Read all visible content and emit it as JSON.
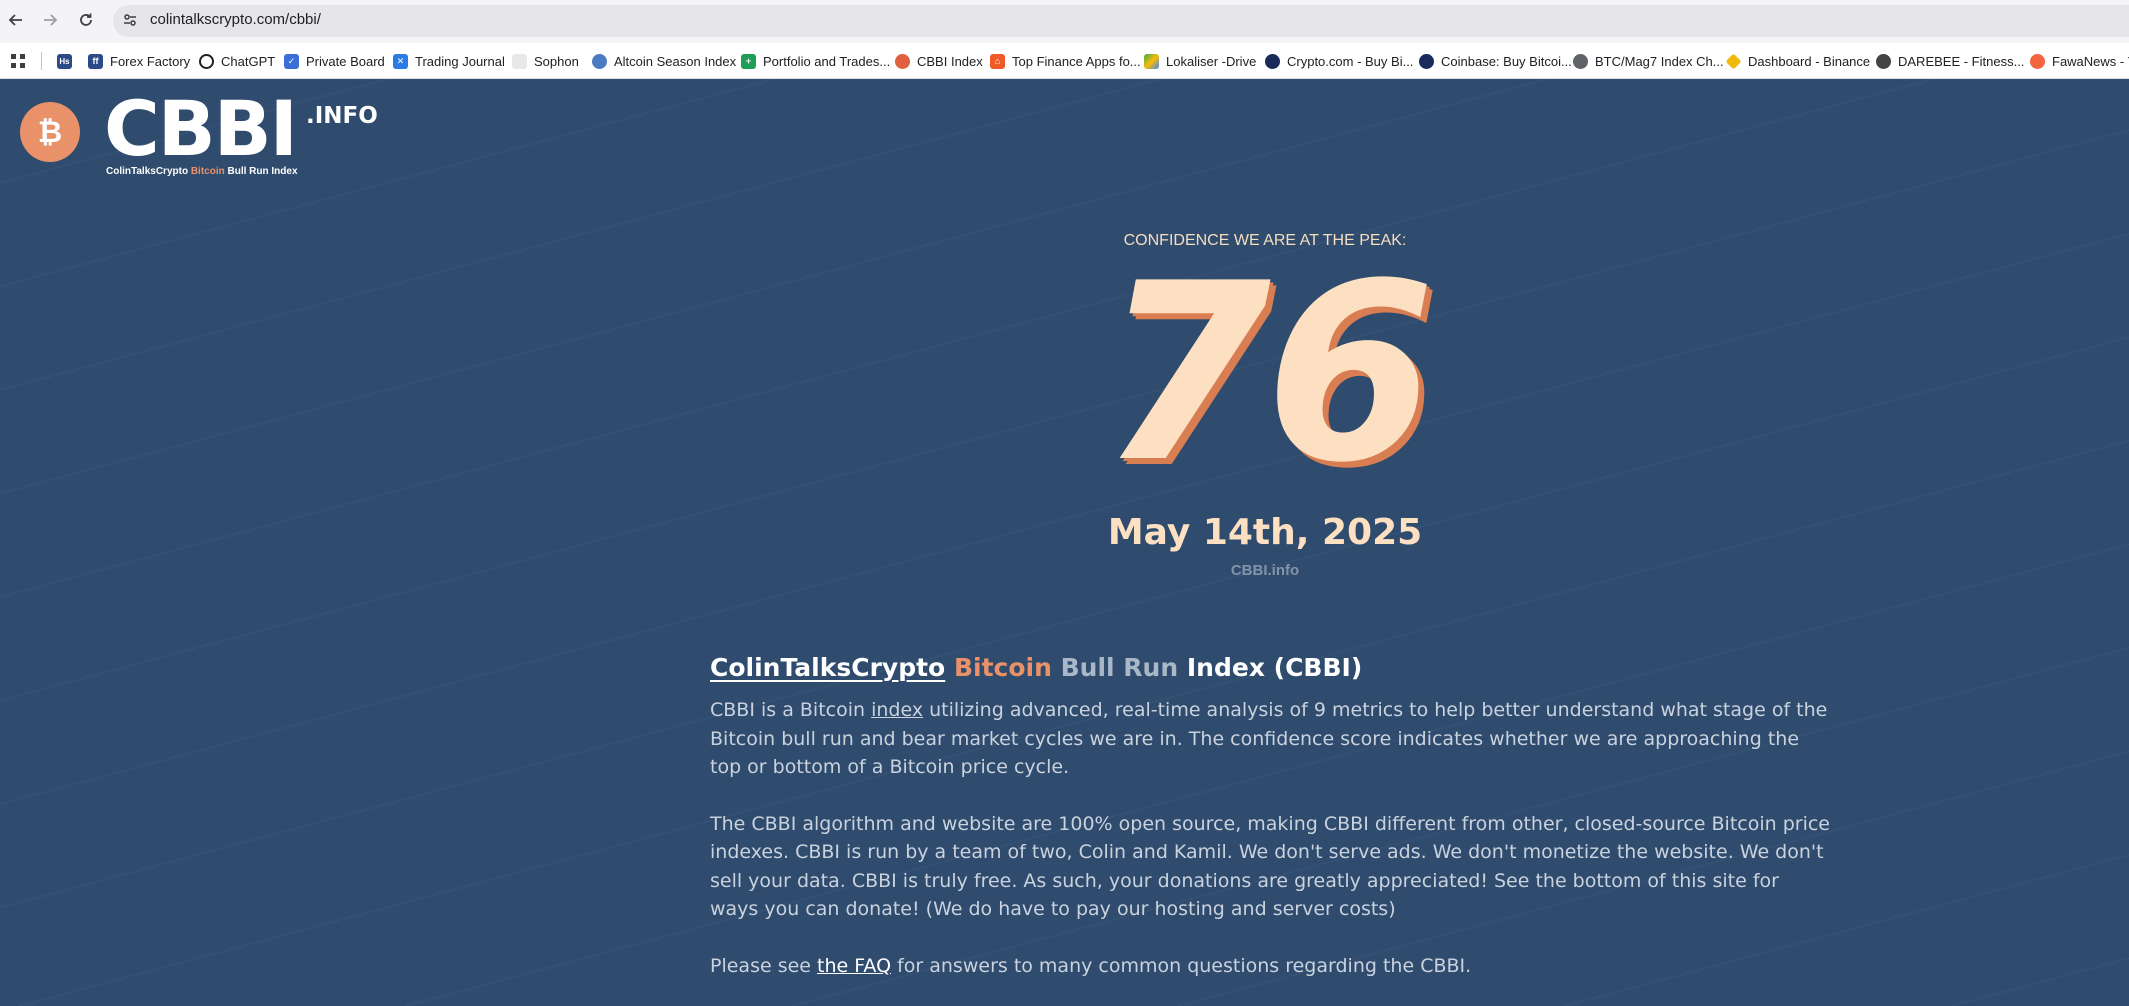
{
  "browser": {
    "url": "colintalkscrypto.com/cbbi/"
  },
  "bookmarks": [
    {
      "label": "Forex Factory",
      "icon": "forex-factory-icon",
      "color": "#2b4a8a"
    },
    {
      "label": "ChatGPT",
      "icon": "chatgpt-icon",
      "color": "#202124"
    },
    {
      "label": "Private Board",
      "icon": "private-board-icon",
      "color": "#3b6fd8"
    },
    {
      "label": "Trading Journal",
      "icon": "trading-journal-icon",
      "color": "#2a7be4"
    },
    {
      "label": "Sophon",
      "icon": "sophon-icon",
      "color": "#cfcfcf"
    },
    {
      "label": "Altcoin Season Index",
      "icon": "altcoin-season-icon",
      "color": "#4a7ac0"
    },
    {
      "label": "Portfolio and Trades...",
      "icon": "sheets-icon",
      "color": "#1e9e57"
    },
    {
      "label": "CBBI Index",
      "icon": "cbbi-icon",
      "color": "#e06040"
    },
    {
      "label": "Top Finance Apps fo...",
      "icon": "finance-apps-icon",
      "color": "#f05a28"
    },
    {
      "label": "Lokaliser -Drive",
      "icon": "drive-icon",
      "color": "#34a853"
    },
    {
      "label": "Crypto.com - Buy Bi...",
      "icon": "crypto-com-icon",
      "color": "#f39c12"
    },
    {
      "label": "Coinbase: Buy Bitcoi...",
      "icon": "coinbase-icon",
      "color": "#f39c12"
    },
    {
      "label": "BTC/Mag7 Index Ch...",
      "icon": "globe-icon",
      "color": "#5f6368"
    },
    {
      "label": "Dashboard - Binance",
      "icon": "binance-icon",
      "color": "#f0b90b"
    },
    {
      "label": "DAREBEE - Fitness...",
      "icon": "darebee-icon",
      "color": "#444444"
    },
    {
      "label": "FawaNews - Yo",
      "icon": "fawanews-icon",
      "color": "#f26540"
    }
  ],
  "logo": {
    "word": "CBBI",
    "suffix": ".INFO",
    "tag_1": "ColinTalksCrypto",
    "tag_2": "Bitcoin",
    "tag_3": "Bull Run Index"
  },
  "hero": {
    "label": "CONFIDENCE WE ARE AT THE PEAK:",
    "value": "76",
    "date": "May 14th, 2025",
    "site": "CBBI.info"
  },
  "article": {
    "title_1": "ColinTalksCrypto",
    "title_2": "Bitcoin",
    "title_3": "Bull Run",
    "title_4": "Index (CBBI)",
    "p1_a": "CBBI is a Bitcoin ",
    "p1_link": "index",
    "p1_b": " utilizing advanced, real-time analysis of 9 metrics to help better understand what stage of the Bitcoin bull run and bear market cycles we are in. The confidence score indicates whether we are approaching the top or bottom of a Bitcoin price cycle.",
    "p2": "The CBBI algorithm and website are 100% open source, making CBBI different from other, closed-source Bitcoin price indexes. CBBI is run by a team of two, Colin and Kamil. We don't serve ads. We don't monetize the website. We don't sell your data. CBBI is truly free. As such, your donations are greatly appreciated! See the bottom of this site for ways you can donate! (We do have to pay our hosting and server costs)",
    "p3_a": "Please see ",
    "p3_link": "the FAQ",
    "p3_b": " for answers to many common questions regarding the CBBI."
  },
  "colors": {
    "background": "#2f4b6d",
    "accent_orange": "#e9926a",
    "cream": "#fde0c2"
  }
}
